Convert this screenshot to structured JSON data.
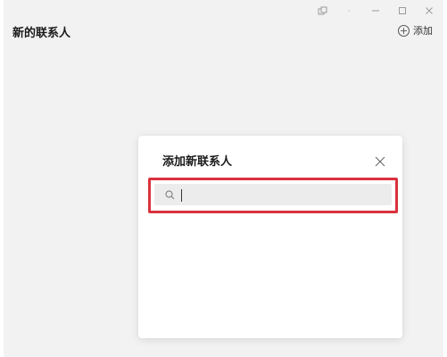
{
  "header": {
    "title": "新的联系人",
    "add_label": "添加",
    "add_icon": "plus-circle-icon"
  },
  "window_controls": {
    "pin_icon": "pin-icon",
    "minimize_icon": "minimize-icon",
    "maximize_icon": "maximize-icon",
    "close_icon": "close-icon"
  },
  "dialog": {
    "title": "添加新联系人",
    "close_icon": "close-icon",
    "search": {
      "icon": "search-icon",
      "value": "",
      "placeholder": ""
    }
  },
  "colors": {
    "highlight": "#d9323d",
    "background": "#f2f2f2",
    "dialog_background": "#ffffff",
    "search_background": "#ececec"
  }
}
